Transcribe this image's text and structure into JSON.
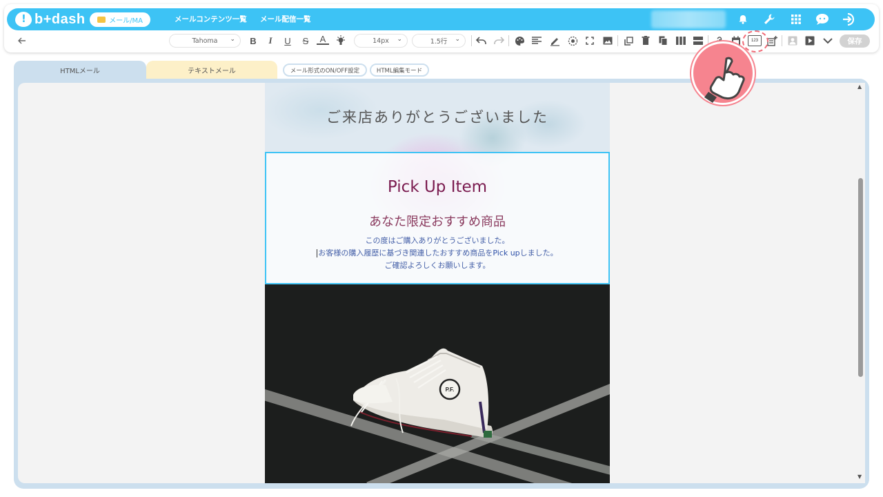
{
  "header": {
    "logo_text": "b+dash",
    "active_nav": "メール/MA",
    "nav_links": [
      "メールコンテンツ一覧",
      "メール配信一覧"
    ],
    "icons": [
      "bell-icon",
      "wrench-icon",
      "grid-icon",
      "chat-icon",
      "logout-icon"
    ]
  },
  "toolbar": {
    "font_family": "Tahoma",
    "font_size": "14px",
    "line_height": "1.5行",
    "counter_label": "123",
    "save_label": "保存"
  },
  "tabs": {
    "html_mail": "HTMLメール",
    "text_mail": "テキストメール",
    "mail_format_toggle": "メール形式のON/OFF設定",
    "html_edit_mode": "HTML編集モード"
  },
  "email": {
    "title": "ご来店ありがとうございました",
    "pick_heading": "Pick Up Item",
    "pick_sub": "あなた限定おすすめ商品",
    "body_line1": "この度はご購入ありがとうございました。",
    "body_line2_prefix": "お客様の購入履歴に基づき関連したおすすめ商品を",
    "body_line2_highlight": "Pick up",
    "body_line2_suffix": "しました。",
    "body_line3": "ご確認よろしくお願いします。",
    "shoe_badge": "P.F."
  },
  "colors": {
    "brand": "#3dc3f5",
    "save_disabled": "#d2d2d2",
    "pick_heading": "#7a1b4f",
    "hint": "#f6848f"
  }
}
